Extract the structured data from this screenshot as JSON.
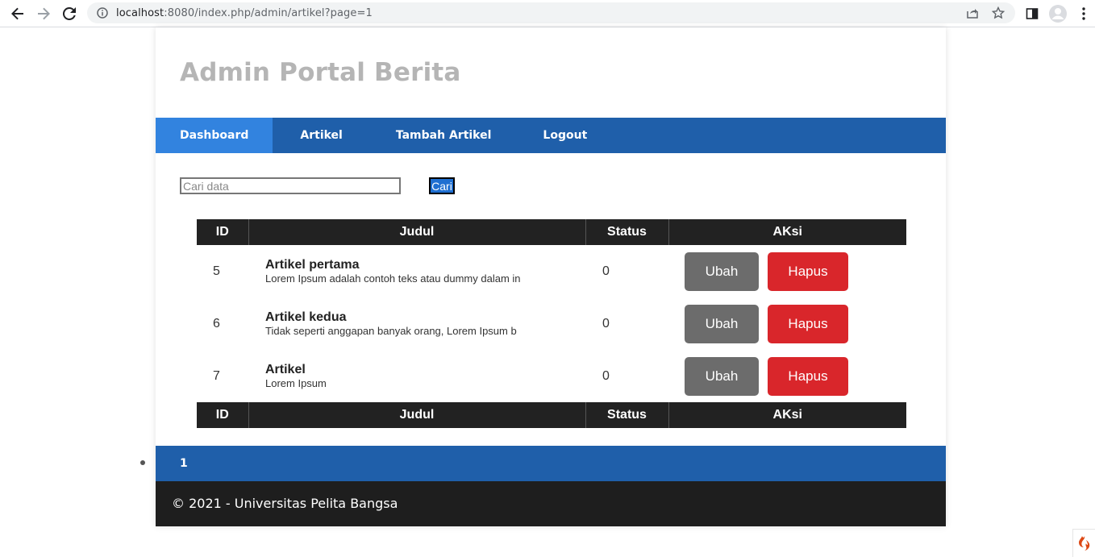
{
  "browser": {
    "url_host": "localhost",
    "url_path": ":8080/index.php/admin/artikel?page=1"
  },
  "header": {
    "title": "Admin Portal Berita"
  },
  "nav": {
    "items": [
      {
        "label": "Dashboard"
      },
      {
        "label": "Artikel"
      },
      {
        "label": "Tambah Artikel"
      },
      {
        "label": "Logout"
      }
    ]
  },
  "search": {
    "placeholder": "Cari data",
    "button_label": "Cari"
  },
  "table": {
    "headers": [
      "ID",
      "Judul",
      "Status",
      "AKsi"
    ],
    "rows": [
      {
        "id": "5",
        "title": "Artikel pertama",
        "snippet": "Lorem Ipsum adalah contoh teks atau dummy dalam in",
        "status": "0",
        "edit": "Ubah",
        "delete": "Hapus"
      },
      {
        "id": "6",
        "title": "Artikel kedua",
        "snippet": "Tidak seperti anggapan banyak orang, Lorem Ipsum b",
        "status": "0",
        "edit": "Ubah",
        "delete": "Hapus"
      },
      {
        "id": "7",
        "title": "Artikel",
        "snippet": "Lorem Ipsum",
        "status": "0",
        "edit": "Ubah",
        "delete": "Hapus"
      }
    ]
  },
  "pagination": {
    "pages": [
      "1"
    ]
  },
  "footer": {
    "text": "© 2021 - Universitas Pelita Bangsa"
  },
  "colors": {
    "navbar": "#1f5faa",
    "nav_active": "#3283df",
    "edit_button": "#6c6c6c",
    "delete_button": "#d9262b",
    "table_header": "#222222",
    "footer": "#1e1e1e"
  },
  "icons": [
    "back-icon",
    "forward-icon",
    "reload-icon",
    "site-info-icon",
    "share-icon",
    "bookmark-star-icon",
    "side-panel-icon",
    "profile-avatar-icon",
    "menu-dots-icon",
    "codeigniter-flame-icon"
  ]
}
